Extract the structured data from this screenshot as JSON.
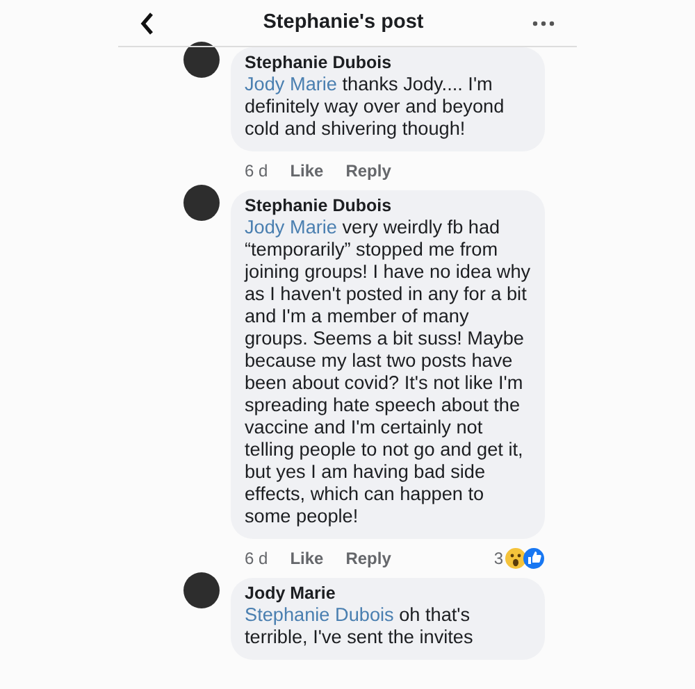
{
  "header": {
    "title": "Stephanie's post"
  },
  "comments": [
    {
      "author": "Stephanie Dubois",
      "mention": "Jody Marie",
      "text": "thanks Jody.... I'm definitely way over and beyond cold and shivering though!",
      "time": "6 d",
      "like": "Like",
      "reply": "Reply"
    },
    {
      "author": "Stephanie Dubois",
      "mention": "Jody Marie",
      "text": "very weirdly fb had “temporarily” stopped me from joining groups! I have no idea why as I haven't posted in any for a bit and I'm a member of many groups. Seems a bit suss! Maybe because my last two posts have been about covid? It's not like I'm spreading hate speech about the vaccine and I'm certainly not telling people to not go and get it, but yes I am having bad side effects, which can happen to some people!",
      "time": "6 d",
      "like": "Like",
      "reply": "Reply",
      "reactions": {
        "count": "3"
      }
    },
    {
      "author": "Jody Marie",
      "mention": "Stephanie Dubois",
      "text": "oh that's terrible, I've sent the invites"
    }
  ]
}
